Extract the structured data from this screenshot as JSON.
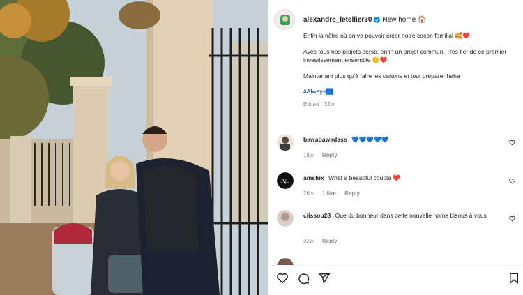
{
  "post": {
    "username": "alexandre_letellier30",
    "header_tag": "New home 🏠",
    "caption_line1": "Enfin la nôtre où on va pouvoir créer notre cocon familial 🥰❤️",
    "caption_line2": "Avec tous nos projets perso, enfin un projet commun. Très fier de ce premier investissement ensemble 😊❤️",
    "caption_line3": "Maintenant plus qu'à faire les cartons et tout préparer haha",
    "hashtag": "#Always🟦",
    "meta": "Edited · 32w"
  },
  "comments": [
    {
      "user": "bawabawadass",
      "text": "💙💙💙💙💙",
      "time": "18w",
      "likes": "",
      "reply": "Reply"
    },
    {
      "user": "amslux",
      "text": "What a beautiful couple ❤️",
      "time": "26w",
      "likes": "1 like",
      "reply": "Reply"
    },
    {
      "user": "ciissou28",
      "text": "Que du bonheur dans cette nouvelle home bisous à vous",
      "time": "32w",
      "likes": "",
      "reply": "Reply"
    }
  ],
  "comment4_avatar_text": "A|L",
  "colors": {
    "heart": "#8e8e8e",
    "link": "#00376b",
    "verified": "#0095f6"
  },
  "icons": [
    "heart-icon",
    "comment-icon",
    "share-icon",
    "bookmark-icon",
    "verified-icon"
  ]
}
